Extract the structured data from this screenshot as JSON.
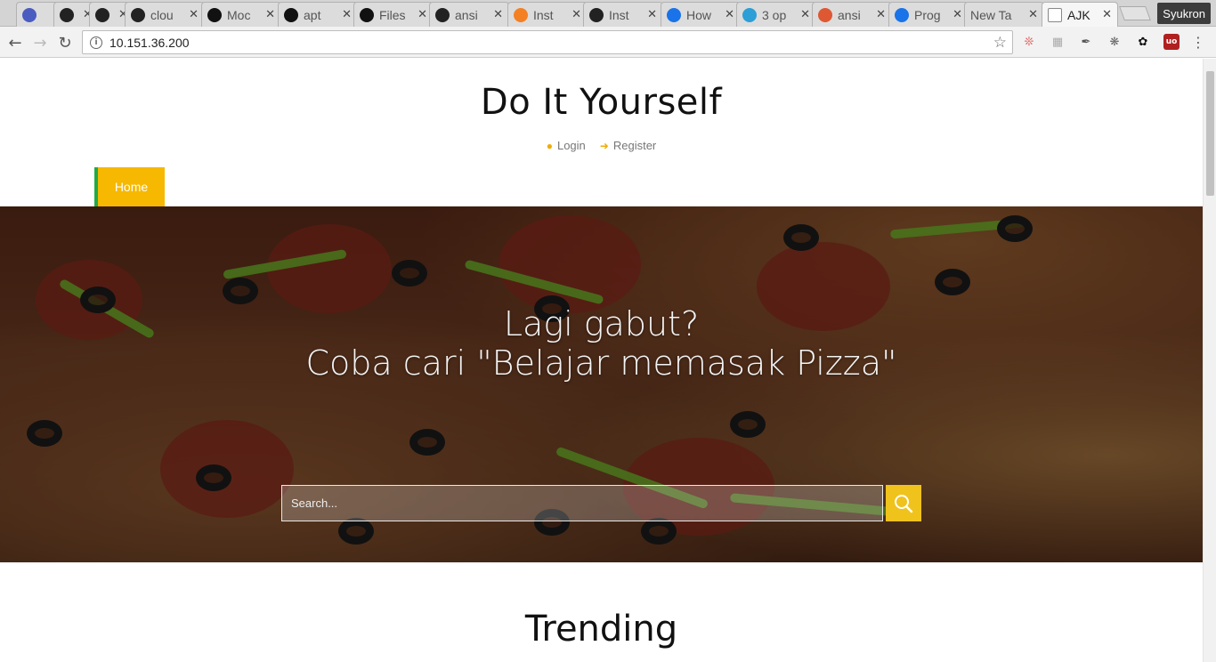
{
  "browser": {
    "tabs": [
      {
        "title": "",
        "favicon": "ul-icon",
        "color": "#4a5cc0"
      },
      {
        "title": "",
        "favicon": "github-icon",
        "color": "#222222"
      },
      {
        "title": "",
        "favicon": "github-icon",
        "color": "#222222"
      },
      {
        "title": "clou",
        "favicon": "github-icon",
        "color": "#222222"
      },
      {
        "title": "Moc",
        "favicon": "angular-icon",
        "color": "#111111"
      },
      {
        "title": "apt",
        "favicon": "angular-icon",
        "color": "#111111"
      },
      {
        "title": "Files",
        "favicon": "angular-icon",
        "color": "#111111"
      },
      {
        "title": "ansi",
        "favicon": "github-icon",
        "color": "#222222"
      },
      {
        "title": "Inst",
        "favicon": "stackoverflow-icon",
        "color": "#f48024"
      },
      {
        "title": "Inst",
        "favicon": "github-icon",
        "color": "#222222"
      },
      {
        "title": "How",
        "favicon": "digitalocean-icon",
        "color": "#1a73e8"
      },
      {
        "title": "3 op",
        "favicon": "grid-icon",
        "color": "#2b9fd6"
      },
      {
        "title": "ansi",
        "favicon": "duckduckgo-icon",
        "color": "#de5833"
      },
      {
        "title": "Prog",
        "favicon": "digitalocean-icon",
        "color": "#1a73e8"
      },
      {
        "title": "New Ta",
        "favicon": "",
        "color": ""
      },
      {
        "title": "AJK",
        "favicon": "page-icon",
        "color": "#888888",
        "active": true
      }
    ],
    "profile": "Syukron",
    "url": "10.151.36.200"
  },
  "site": {
    "title": "Do It Yourself",
    "login": "Login",
    "register": "Register",
    "nav_home": "Home"
  },
  "hero": {
    "line1": "Lagi gabut?",
    "line2": "Coba cari \"Belajar memasak Pizza\"",
    "search_placeholder": "Search..."
  },
  "section": {
    "trending": "Trending"
  }
}
